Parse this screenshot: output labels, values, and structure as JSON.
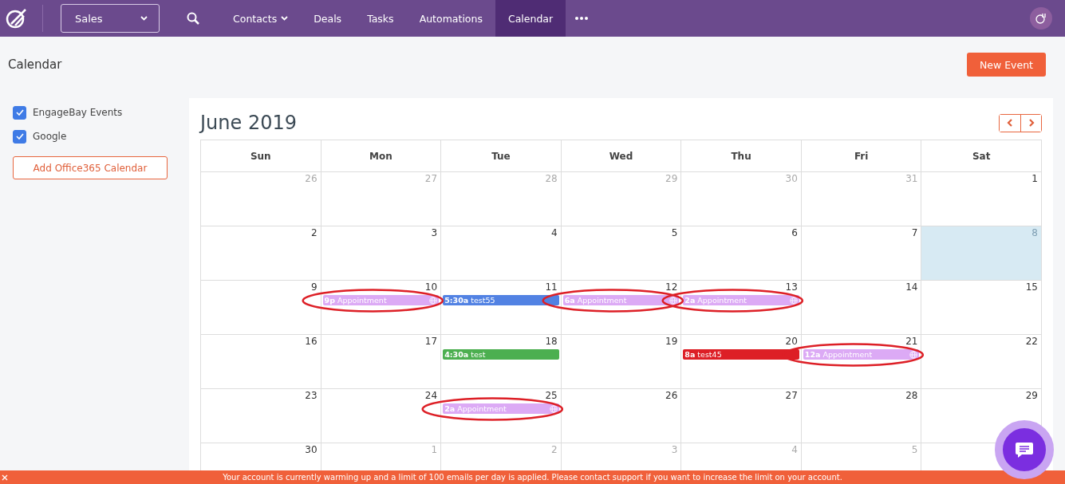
{
  "nav": {
    "workspace": "Sales",
    "items": [
      {
        "label": "Contacts",
        "kind": "dropdown",
        "selected": false
      },
      {
        "label": "Deals",
        "kind": "link",
        "selected": false
      },
      {
        "label": "Tasks",
        "kind": "link",
        "selected": false
      },
      {
        "label": "Automations",
        "kind": "link",
        "selected": false
      },
      {
        "label": "Calendar",
        "kind": "link",
        "selected": true
      }
    ]
  },
  "page": {
    "title": "Calendar",
    "new_button": "New Event"
  },
  "sidebar": {
    "calendars": [
      {
        "label": "EngageBay Events",
        "checked": true
      },
      {
        "label": "Google",
        "checked": true
      }
    ],
    "add_button": "Add Office365 Calendar"
  },
  "calendar": {
    "title": "June 2019",
    "weekdays": [
      "Sun",
      "Mon",
      "Tue",
      "Wed",
      "Thu",
      "Fri",
      "Sat"
    ],
    "weeks": [
      {
        "days": [
          {
            "number": "26",
            "muted": true,
            "today": false
          },
          {
            "number": "27",
            "muted": true,
            "today": false
          },
          {
            "number": "28",
            "muted": true,
            "today": false
          },
          {
            "number": "29",
            "muted": true,
            "today": false
          },
          {
            "number": "30",
            "muted": true,
            "today": false
          },
          {
            "number": "31",
            "muted": true,
            "today": false
          },
          {
            "number": "1",
            "muted": false,
            "today": false
          }
        ]
      },
      {
        "days": [
          {
            "number": "2",
            "muted": false,
            "today": false
          },
          {
            "number": "3",
            "muted": false,
            "today": false
          },
          {
            "number": "4",
            "muted": false,
            "today": false
          },
          {
            "number": "5",
            "muted": false,
            "today": false
          },
          {
            "number": "6",
            "muted": false,
            "today": false
          },
          {
            "number": "7",
            "muted": false,
            "today": false
          },
          {
            "number": "8",
            "muted": false,
            "today": true
          }
        ]
      },
      {
        "days": [
          {
            "number": "9",
            "muted": false,
            "today": false
          },
          {
            "number": "10",
            "muted": false,
            "today": false,
            "events": [
              {
                "time": "9p",
                "title": "Appointment",
                "kind": "external",
                "color": "#dcaaf5",
                "circled": true
              }
            ]
          },
          {
            "number": "11",
            "muted": false,
            "today": false,
            "events": [
              {
                "time": "5:30a",
                "title": "test55",
                "kind": "internal",
                "color": "#5282e3",
                "circled": false
              }
            ]
          },
          {
            "number": "12",
            "muted": false,
            "today": false,
            "events": [
              {
                "time": "6a",
                "title": "Appointment",
                "kind": "external",
                "color": "#dcaaf5",
                "circled": true
              }
            ]
          },
          {
            "number": "13",
            "muted": false,
            "today": false,
            "events": [
              {
                "time": "2a",
                "title": "Appointment",
                "kind": "external",
                "color": "#dcaaf5",
                "circled": true
              }
            ]
          },
          {
            "number": "14",
            "muted": false,
            "today": false
          },
          {
            "number": "15",
            "muted": false,
            "today": false
          }
        ]
      },
      {
        "days": [
          {
            "number": "16",
            "muted": false,
            "today": false
          },
          {
            "number": "17",
            "muted": false,
            "today": false
          },
          {
            "number": "18",
            "muted": false,
            "today": false,
            "events": [
              {
                "time": "4:30a",
                "title": "test",
                "kind": "internal",
                "color": "#4caf50",
                "circled": false
              }
            ]
          },
          {
            "number": "19",
            "muted": false,
            "today": false
          },
          {
            "number": "20",
            "muted": false,
            "today": false,
            "events": [
              {
                "time": "8a",
                "title": "test45",
                "kind": "internal",
                "color": "#dd1f26",
                "circled": false
              }
            ]
          },
          {
            "number": "21",
            "muted": false,
            "today": false,
            "events": [
              {
                "time": "12a",
                "title": "Appointment",
                "kind": "external",
                "color": "#dcaaf5",
                "circled": true
              }
            ]
          },
          {
            "number": "22",
            "muted": false,
            "today": false
          }
        ]
      },
      {
        "days": [
          {
            "number": "23",
            "muted": false,
            "today": false
          },
          {
            "number": "24",
            "muted": false,
            "today": false
          },
          {
            "number": "25",
            "muted": false,
            "today": false,
            "events": [
              {
                "time": "2a",
                "title": "Appointment",
                "kind": "external",
                "color": "#dcaaf5",
                "circled": true
              }
            ]
          },
          {
            "number": "26",
            "muted": false,
            "today": false
          },
          {
            "number": "27",
            "muted": false,
            "today": false
          },
          {
            "number": "28",
            "muted": false,
            "today": false
          },
          {
            "number": "29",
            "muted": false,
            "today": false
          }
        ]
      },
      {
        "days": [
          {
            "number": "30",
            "muted": false,
            "today": false
          },
          {
            "number": "1",
            "muted": true,
            "today": false
          },
          {
            "number": "2",
            "muted": true,
            "today": false
          },
          {
            "number": "3",
            "muted": true,
            "today": false
          },
          {
            "number": "4",
            "muted": true,
            "today": false
          },
          {
            "number": "5",
            "muted": true,
            "today": false
          }
        ]
      }
    ]
  },
  "banner": {
    "text": "Your account is currently warming up and a limit of 100 emails per day is applied. Please contact support if you want to increase the limit on your account."
  }
}
